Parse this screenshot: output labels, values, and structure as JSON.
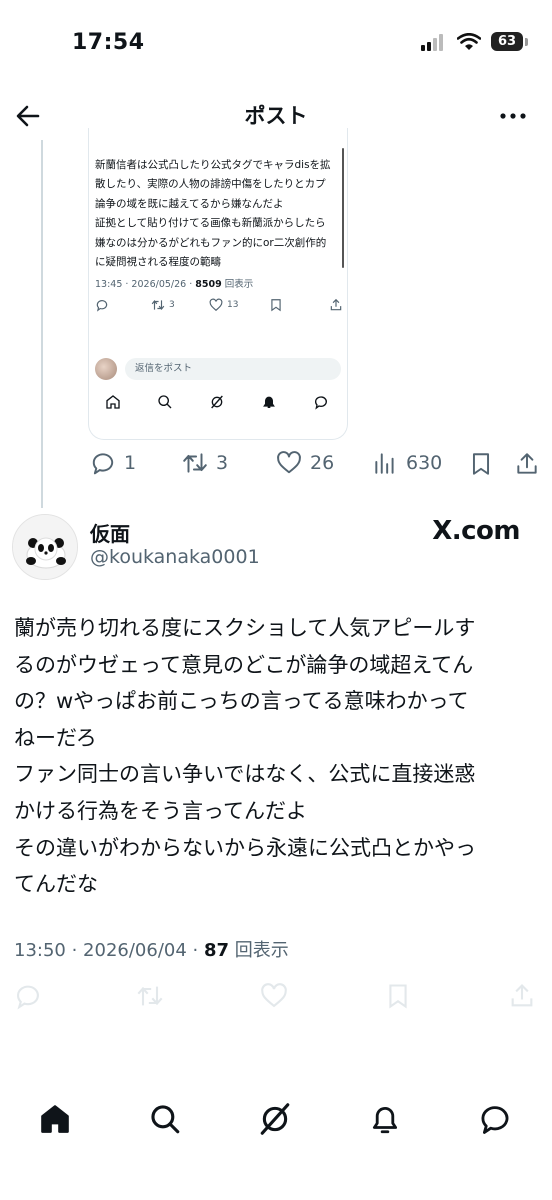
{
  "status_bar": {
    "time": "17:54",
    "battery": "63"
  },
  "nav": {
    "title": "ポスト"
  },
  "embedded_post": {
    "lines": [
      "新蘭信者は公式凸したり公式タグでキャラdisを拡",
      "散したり、実際の人物の誹謗中傷をしたりとカプ",
      "論争の域を既に越えてるから嫌なんだよ",
      "証拠として貼り付けてる画像も新蘭派からしたら",
      "嫌なのは分かるがどれもファン的にor二次創作的",
      "に疑問視される程度の範疇"
    ],
    "meta_prefix": "13:45 · 2026/05/26 · ",
    "views": "8509",
    "views_label": "回表示",
    "retweets": "3",
    "likes": "13",
    "reply_placeholder": "返信をポスト"
  },
  "parent_stats": {
    "replies": "1",
    "reposts": "3",
    "likes": "26",
    "views": "630"
  },
  "tweet": {
    "author_name": "仮面",
    "author_handle": "@koukanaka0001",
    "watermark": "X.com",
    "body": "蘭が売り切れる度にスクショして人気アピールす\nるのがウゼェって意見のどこが論争の域超えてん\nの？wやっぱお前こっちの言ってる意味わかって\nねーだろ\nファン同士の言い争いではなく、公式に直接迷惑\nかける行為をそう言ってんだよ\nその違いがわからないから永遠に公式凸とかやっ\nてんだな",
    "meta_prefix": "13:50 · 2026/06/04 · ",
    "views": "87",
    "views_label": "回表示"
  },
  "icons": {
    "status": [
      "signal-icon",
      "wifi-icon",
      "battery-icon"
    ],
    "nav": [
      "back-arrow-icon",
      "more-icon"
    ],
    "actions": [
      "reply-icon",
      "repost-icon",
      "like-icon",
      "views-icon",
      "bookmark-icon",
      "share-icon"
    ],
    "tabbar": [
      "home-icon",
      "search-icon",
      "grok-icon",
      "notifications-icon",
      "messages-icon"
    ]
  }
}
